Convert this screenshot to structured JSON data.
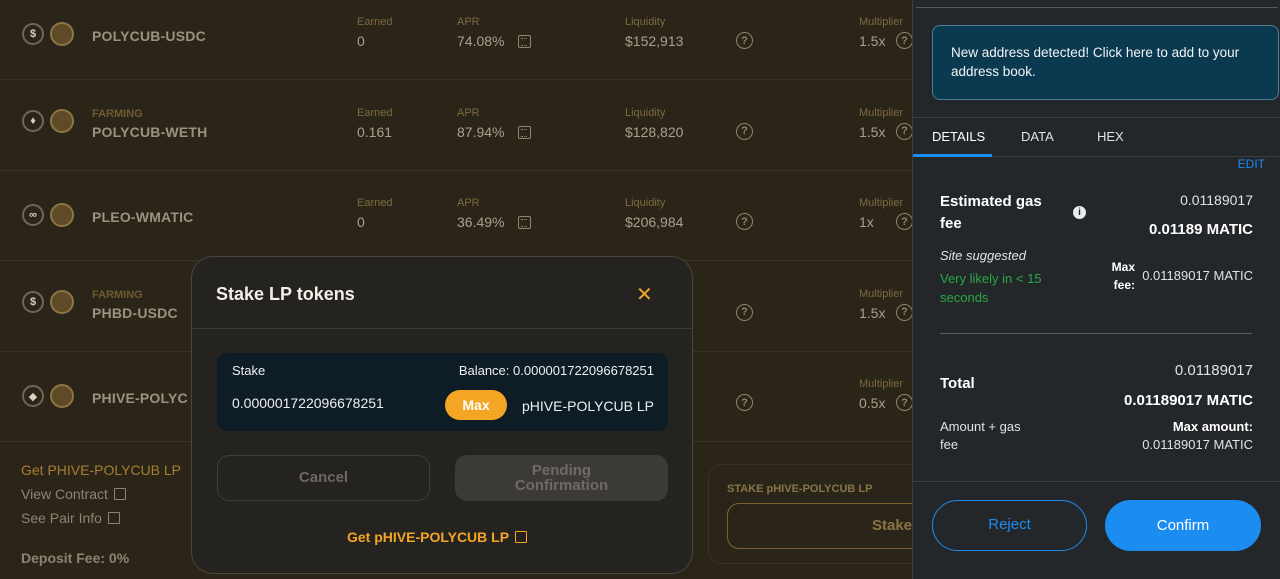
{
  "farms": [
    {
      "tag": "",
      "name": "POLYCUB-USDC",
      "earned_label": "Earned",
      "earned": "0",
      "apr_label": "APR",
      "apr": "74.08%",
      "liq_label": "Liquidity",
      "liquidity": "$152,913",
      "mult_label": "Multiplier",
      "multiplier": "1.5x",
      "token_a": "$"
    },
    {
      "tag": "FARMING",
      "name": "POLYCUB-WETH",
      "earned_label": "Earned",
      "earned": "0.161",
      "apr_label": "APR",
      "apr": "87.94%",
      "liq_label": "Liquidity",
      "liquidity": "$128,820",
      "mult_label": "Multiplier",
      "multiplier": "1.5x",
      "token_a": "♦"
    },
    {
      "tag": "",
      "name": "PLEO-WMATIC",
      "earned_label": "Earned",
      "earned": "0",
      "apr_label": "APR",
      "apr": "36.49%",
      "liq_label": "Liquidity",
      "liquidity": "$206,984",
      "mult_label": "Multiplier",
      "multiplier": "1x",
      "token_a": "∞"
    },
    {
      "tag": "FARMING",
      "name": "PHBD-USDC",
      "earned_label": "",
      "earned": "",
      "apr_label": "",
      "apr": "",
      "liq_label": "",
      "liquidity": "",
      "mult_label": "Multiplier",
      "multiplier": "1.5x",
      "token_a": "$"
    },
    {
      "tag": "",
      "name": "PHIVE-POLYC",
      "earned_label": "",
      "earned": "",
      "apr_label": "",
      "apr": "",
      "liq_label": "",
      "liquidity": "",
      "mult_label": "Multiplier",
      "multiplier": "0.5x",
      "token_a": "◆"
    }
  ],
  "details_links": {
    "get_lp": "Get PHIVE-POLYCUB LP",
    "view_contract": "View Contract",
    "see_pair_info": "See Pair Info",
    "deposit_fee": "Deposit Fee: 0%"
  },
  "stake_box": {
    "label": "STAKE pHIVE-POLYCUB LP",
    "button": "Stake"
  },
  "modal": {
    "title": "Stake LP tokens",
    "stake_label": "Stake",
    "balance_label": "Balance: 0.000001722096678251",
    "amount": "0.000001722096678251",
    "max_label": "Max",
    "token": "pHIVE-POLYCUB LP",
    "cancel": "Cancel",
    "pending_line1": "Pending",
    "pending_line2": "Confirmation",
    "get_lp": "Get pHIVE-POLYCUB LP"
  },
  "metamask": {
    "notice": "New address detected! Click here to add to your address book.",
    "tabs": [
      "DETAILS",
      "DATA",
      "HEX"
    ],
    "edit": "EDIT",
    "gas_label_1": "Estimated gas",
    "gas_label_2": "fee",
    "gas_value_small": "0.01189017",
    "gas_value": "0.01189 MATIC",
    "site_suggested": "Site suggested",
    "likely_1": "Very likely in < 15",
    "likely_2": "seconds",
    "max_fee_label_1": "Max",
    "max_fee_label_2": "fee:",
    "max_fee_value": "0.01189017 MATIC",
    "total_label": "Total",
    "total_small": "0.01189017",
    "total_value": "0.01189017 MATIC",
    "amount_gas_1": "Amount + gas",
    "amount_gas_2": "fee",
    "max_amount_label": "Max amount:",
    "max_amount_value": "0.01189017 MATIC",
    "reject": "Reject",
    "confirm": "Confirm"
  },
  "colors": {
    "accent": "#f5a524",
    "metamask_blue": "#1b8cf0",
    "likely_green": "#28a745"
  }
}
